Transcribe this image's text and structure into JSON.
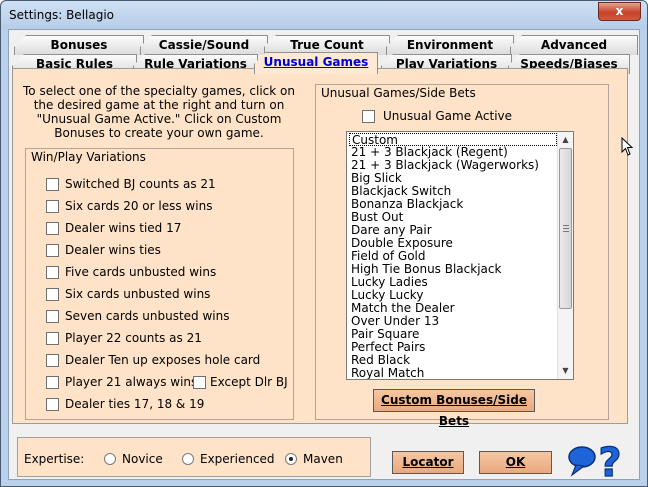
{
  "window": {
    "title": "Settings: Bellagio",
    "close_label": "x"
  },
  "tabs_back": [
    "Bonuses",
    "Cassie/Sound",
    "True Count",
    "Environment",
    "Advanced"
  ],
  "tabs_front": [
    "Basic Rules",
    "Rule Variations",
    "Unusual Games",
    "Play Variations",
    "Speeds/Biases"
  ],
  "active_tab": "Unusual Games",
  "intro": "To select one of the specialty games, click on the desired game at the right and turn on \"Unusual Game Active.\"  Click on Custom Bonuses to create your own game.",
  "win_play": {
    "title": "Win/Play Variations",
    "items": [
      {
        "label": "Switched BJ counts as 21",
        "checked": false
      },
      {
        "label": "Six cards 20 or less wins",
        "checked": false
      },
      {
        "label": "Dealer wins tied 17",
        "checked": false
      },
      {
        "label": "Dealer wins ties",
        "checked": false
      },
      {
        "label": "Five cards unbusted wins",
        "checked": false
      },
      {
        "label": "Six cards unbusted wins",
        "checked": false
      },
      {
        "label": "Seven cards unbusted wins",
        "checked": false
      },
      {
        "label": "Player 22 counts as 21",
        "checked": false
      },
      {
        "label": "Dealer Ten up exposes hole card",
        "checked": false
      },
      {
        "label": "Player 21 always wins",
        "checked": false
      },
      {
        "label": "Dealer ties 17, 18 & 19",
        "checked": false
      }
    ],
    "except_label": "Except Dlr BJ"
  },
  "unusual": {
    "title": "Unusual Games/Side Bets",
    "active_label": "Unusual Game Active",
    "games": [
      "Custom",
      "21 + 3 Blackjack (Regent)",
      "21 + 3 Blackjack (Wagerworks)",
      "Big Slick",
      "Blackjack Switch",
      "Bonanza Blackjack",
      "Bust Out",
      "Dare any Pair",
      "Double Exposure",
      "Field of Gold",
      "High Tie Bonus Blackjack",
      "Lucky Ladies",
      "Lucky Lucky",
      "Match the Dealer",
      "Over Under 13",
      "Pair Square",
      "Perfect Pairs",
      "Red Black",
      "Royal Match"
    ],
    "selected": "Custom",
    "custom_button": "Custom Bonuses/Side Bets"
  },
  "expertise": {
    "label": "Expertise:",
    "options": [
      "Novice",
      "Experienced",
      "Maven"
    ],
    "selected": "Maven"
  },
  "buttons": {
    "locator": "Locator",
    "ok": "OK"
  },
  "colors": {
    "panel": "#ffe3c8",
    "button": "#eeb48c",
    "active_tab_text": "#0000cc",
    "help_icon": "#1e63d8"
  }
}
